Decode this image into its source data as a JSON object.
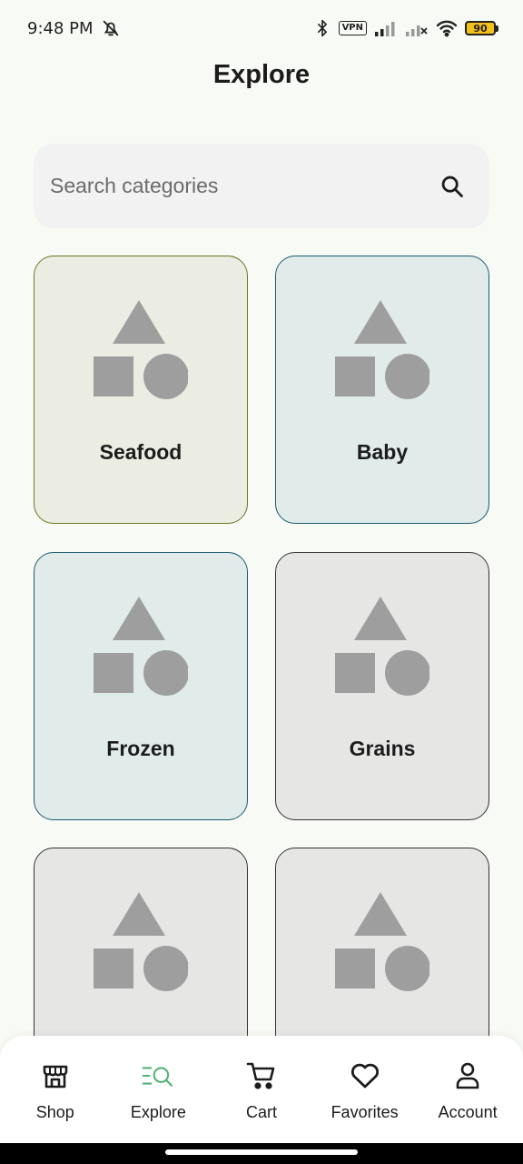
{
  "status_bar": {
    "time": "9:48 PM",
    "vpn_label": "VPN",
    "battery_level": "90",
    "icons": [
      "notifications-off-icon",
      "bluetooth-icon",
      "vpn-icon",
      "signal-icon",
      "signal-no-service-icon",
      "wifi-icon",
      "battery-icon"
    ]
  },
  "header": {
    "title": "Explore"
  },
  "search": {
    "placeholder": "Search categories",
    "value": "",
    "icon": "search-icon"
  },
  "categories": [
    {
      "label": "Seafood",
      "bg": "#ebede2",
      "border": "#6f7424"
    },
    {
      "label": "Baby",
      "bg": "#e0ebea",
      "border": "#1a5a6d"
    },
    {
      "label": "Frozen",
      "bg": "#e0ebea",
      "border": "#1a5a6d"
    },
    {
      "label": "Grains",
      "bg": "#e6e7e5",
      "border": "#333333"
    },
    {
      "label": "",
      "bg": "#e6e7e5",
      "border": "#333333"
    },
    {
      "label": "",
      "bg": "#e6e7e5",
      "border": "#333333"
    }
  ],
  "bottom_nav": {
    "active_index": 1,
    "active_color": "#53b175",
    "items": [
      {
        "label": "Shop",
        "icon": "shop-icon"
      },
      {
        "label": "Explore",
        "icon": "explore-icon"
      },
      {
        "label": "Cart",
        "icon": "cart-icon"
      },
      {
        "label": "Favorites",
        "icon": "heart-icon"
      },
      {
        "label": "Account",
        "icon": "account-icon"
      }
    ]
  },
  "colors": {
    "background": "#f8faf6",
    "search_bg": "#f2f2f2",
    "placeholder_shape": "#9e9e9e",
    "text": "#1c1c1c"
  }
}
